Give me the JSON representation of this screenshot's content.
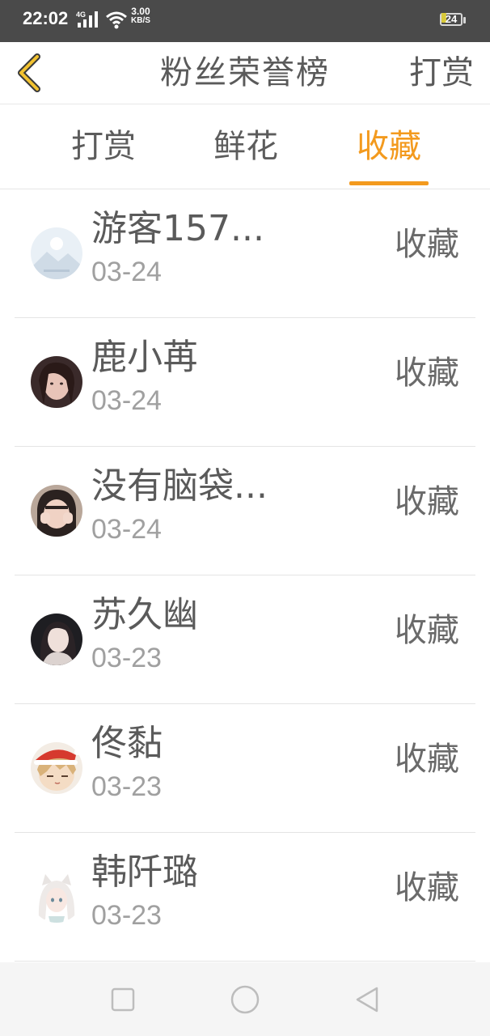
{
  "status_bar": {
    "time": "22:02",
    "network_type": "4G",
    "speed_value": "3.00",
    "speed_unit": "KB/S",
    "battery_level": "24"
  },
  "header": {
    "title": "粉丝荣誉榜",
    "action_label": "打赏"
  },
  "tabs": [
    {
      "label": "打赏",
      "active": false
    },
    {
      "label": "鲜花",
      "active": false
    },
    {
      "label": "收藏",
      "active": true
    }
  ],
  "list": [
    {
      "name": "游客157...",
      "date": "03-24",
      "action": "收藏",
      "avatar": "landscape-placeholder-avatar"
    },
    {
      "name": "鹿小苒",
      "date": "03-24",
      "action": "收藏",
      "avatar": "user-photo-avatar"
    },
    {
      "name": "没有脑袋...",
      "date": "03-24",
      "action": "收藏",
      "avatar": "user-photo-avatar"
    },
    {
      "name": "苏久幽",
      "date": "03-23",
      "action": "收藏",
      "avatar": "user-photo-avatar"
    },
    {
      "name": "佟黏",
      "date": "03-23",
      "action": "收藏",
      "avatar": "anime-christmas-avatar"
    },
    {
      "name": "韩阡璐",
      "date": "03-23",
      "action": "收藏",
      "avatar": "anime-cat-girl-avatar"
    }
  ],
  "nav_bar": {
    "buttons": [
      "recents-square-icon",
      "home-circle-icon",
      "back-triangle-icon"
    ]
  },
  "colors": {
    "accent": "#f39a1e",
    "status_bar_bg": "#4a4a4a",
    "text_primary": "#5a5a5a",
    "text_secondary": "#a0a0a0",
    "back_arrow": "#f2c230"
  }
}
